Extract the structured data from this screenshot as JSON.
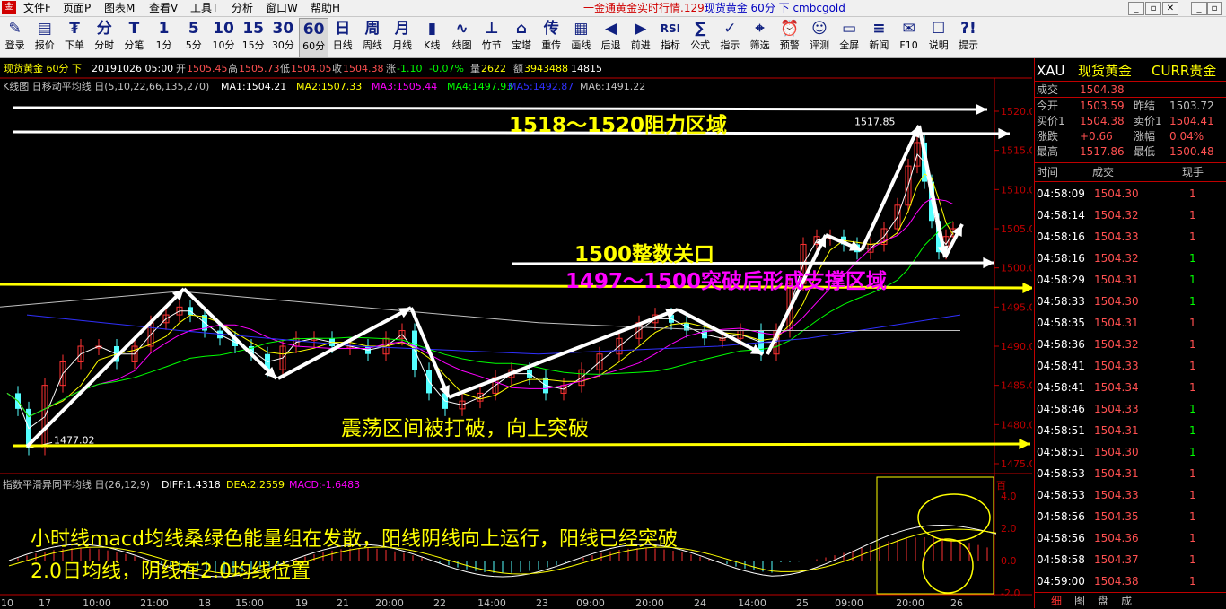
{
  "app": {
    "menus": [
      "文件F",
      "页面P",
      "图表M",
      "查看V",
      "工具T",
      "分析",
      "窗口W",
      "帮助H"
    ],
    "title_prefix": "一金通黄金实时行情.129",
    "title_main": "现货黄金 60分 下 cmbcgold",
    "window_buttons": [
      "_",
      "▫",
      "✕",
      "_",
      "▫",
      "✕"
    ]
  },
  "toolbar": [
    {
      "icon": "✎",
      "label": "登录"
    },
    {
      "icon": "▤",
      "label": "报价"
    },
    {
      "icon": "₮",
      "label": "下单"
    },
    {
      "icon": "分",
      "label": "分时"
    },
    {
      "icon": "T",
      "label": "分笔"
    },
    {
      "icon": "1",
      "label": "1分"
    },
    {
      "icon": "5",
      "label": "5分"
    },
    {
      "icon": "10",
      "label": "10分"
    },
    {
      "icon": "15",
      "label": "15分"
    },
    {
      "icon": "30",
      "label": "30分"
    },
    {
      "icon": "60",
      "label": "60分"
    },
    {
      "icon": "日",
      "label": "日线"
    },
    {
      "icon": "周",
      "label": "周线"
    },
    {
      "icon": "月",
      "label": "月线"
    },
    {
      "icon": "▮",
      "label": "K线"
    },
    {
      "icon": "∿",
      "label": "线图"
    },
    {
      "icon": "⊥",
      "label": "竹节"
    },
    {
      "icon": "⌂",
      "label": "宝塔"
    },
    {
      "icon": "传",
      "label": "重传"
    },
    {
      "icon": "▦",
      "label": "画线"
    },
    {
      "icon": "◀",
      "label": "后退"
    },
    {
      "icon": "▶",
      "label": "前进"
    },
    {
      "icon": "RSI",
      "label": "指标"
    },
    {
      "icon": "∑",
      "label": "公式"
    },
    {
      "icon": "✓",
      "label": "指示"
    },
    {
      "icon": "⌖",
      "label": "筛选"
    },
    {
      "icon": "⏰",
      "label": "预警"
    },
    {
      "icon": "☺",
      "label": "评测"
    },
    {
      "icon": "▭",
      "label": "全屏"
    },
    {
      "icon": "≡",
      "label": "新闻"
    },
    {
      "icon": "✉",
      "label": "F10"
    },
    {
      "icon": "☐",
      "label": "说明"
    },
    {
      "icon": "?!",
      "label": "提示"
    }
  ],
  "chart": {
    "info_line": {
      "name": "现货黄金 60分 下",
      "datetime": "20191026 05:00",
      "open_label": "开",
      "open": "1505.45",
      "high_label": "高",
      "high": "1505.73",
      "low_label": "低",
      "low": "1504.05",
      "close_label": "收",
      "close": "1504.38",
      "change_label": "涨",
      "change": "-1.10",
      "change_pct": "-0.07%",
      "volume_label": "量",
      "volume": "2622",
      "hold_label": "额",
      "hold": "3943488",
      "extra": "14815"
    },
    "indicator_line": {
      "name": "K线图 日移动平均线 日(5,10,22,66,135,270)",
      "ma1": "MA1:1504.21",
      "ma2": "MA2:1507.33",
      "ma3": "MA3:1505.44",
      "ma4": "MA4:1497.93",
      "ma5": "MA5:1492.87",
      "ma6": "MA6:1491.22"
    },
    "macd_line": {
      "name": "指数平滑异同平均线 日(26,12,9)",
      "diff": "DIFF:1.4318",
      "dea": "DEA:2.2559",
      "macd": "MACD:-1.6483"
    },
    "y_axis": [
      "1520.0",
      "1515.0",
      "1510.0",
      "1505.0",
      "1500.0",
      "1495.0",
      "1490.0",
      "1485.0",
      "1480.0",
      "1475.0"
    ],
    "y_unit_label": "百",
    "macd_axis": [
      "4.0",
      "2.0",
      "0.0",
      "-2.0"
    ],
    "x_axis": [
      "10",
      "17",
      "10:00",
      "21:00",
      "18",
      "15:00",
      "19",
      "21",
      "20:00",
      "22",
      "14:00",
      "23",
      "09:00",
      "20:00",
      "24",
      "14:00",
      "25",
      "09:00",
      "20:00",
      "26"
    ],
    "price_labels": {
      "low": "1477.02",
      "high": "1517.85"
    },
    "colors": {
      "up": "#ff3232",
      "down": "#54ffff",
      "ma1": "#ffffff",
      "ma2": "#ffff00",
      "ma3": "#ff00ff",
      "ma4": "#00ff00",
      "ma5": "#3030ff",
      "ma6": "#c0c0c0",
      "axis": "#c00000",
      "annotation_white": "#ffffff",
      "annotation_yellow": "#ffff00",
      "annotation_magenta": "#ff00ff"
    }
  },
  "annotations": {
    "resistance": "1518～1520阻力区域",
    "round_number": "1500整数关口",
    "support": "1497～1500突破后形成支撑区域",
    "breakout": "震荡区间被打破，向上突破",
    "macd_note_line1": "小时线macd均线桑绿色能量组在发散，阳线阴线向上运行，阳线已经突破",
    "macd_note_line2": "2.0日均线，阴线在2.0均线位置"
  },
  "quote_panel": {
    "header": {
      "symbol": "XAU",
      "name": "现货黄金",
      "market": "CURR贵金"
    },
    "last": {
      "label": "成交",
      "value": "1504.38"
    },
    "rows": [
      {
        "l1": "今开",
        "v1": "1503.59",
        "l2": "昨结",
        "v2": "1503.72"
      },
      {
        "l1": "买价1",
        "v1": "1504.38",
        "l2": "卖价1",
        "v2": "1504.41"
      },
      {
        "l1": "涨跌",
        "v1": "+0.66",
        "l2": "涨幅",
        "v2": "0.04%"
      },
      {
        "l1": "最高",
        "v1": "1517.86",
        "l2": "最低",
        "v2": "1500.48"
      }
    ],
    "tick_headers": [
      "时间",
      "成交",
      "现手"
    ],
    "ticks": [
      {
        "time": "04:58:09",
        "price": "1504.30",
        "vol": "1",
        "dir": "up"
      },
      {
        "time": "04:58:14",
        "price": "1504.32",
        "vol": "1",
        "dir": "up"
      },
      {
        "time": "04:58:16",
        "price": "1504.33",
        "vol": "1",
        "dir": "up"
      },
      {
        "time": "04:58:16",
        "price": "1504.32",
        "vol": "1",
        "dir": "down"
      },
      {
        "time": "04:58:29",
        "price": "1504.31",
        "vol": "1",
        "dir": "down"
      },
      {
        "time": "04:58:33",
        "price": "1504.30",
        "vol": "1",
        "dir": "down"
      },
      {
        "time": "04:58:35",
        "price": "1504.31",
        "vol": "1",
        "dir": "up"
      },
      {
        "time": "04:58:36",
        "price": "1504.32",
        "vol": "1",
        "dir": "up"
      },
      {
        "time": "04:58:41",
        "price": "1504.33",
        "vol": "1",
        "dir": "up"
      },
      {
        "time": "04:58:41",
        "price": "1504.34",
        "vol": "1",
        "dir": "up"
      },
      {
        "time": "04:58:46",
        "price": "1504.33",
        "vol": "1",
        "dir": "down"
      },
      {
        "time": "04:58:51",
        "price": "1504.31",
        "vol": "1",
        "dir": "down"
      },
      {
        "time": "04:58:51",
        "price": "1504.30",
        "vol": "1",
        "dir": "down"
      },
      {
        "time": "04:58:53",
        "price": "1504.31",
        "vol": "1",
        "dir": "up"
      },
      {
        "time": "04:58:53",
        "price": "1504.33",
        "vol": "1",
        "dir": "up"
      },
      {
        "time": "04:58:56",
        "price": "1504.35",
        "vol": "1",
        "dir": "up"
      },
      {
        "time": "04:58:56",
        "price": "1504.36",
        "vol": "1",
        "dir": "up"
      },
      {
        "time": "04:58:58",
        "price": "1504.37",
        "vol": "1",
        "dir": "up"
      },
      {
        "time": "04:59:00",
        "price": "1504.38",
        "vol": "1",
        "dir": "up"
      }
    ],
    "tabs": [
      "细",
      "图",
      "盘",
      "成"
    ]
  }
}
